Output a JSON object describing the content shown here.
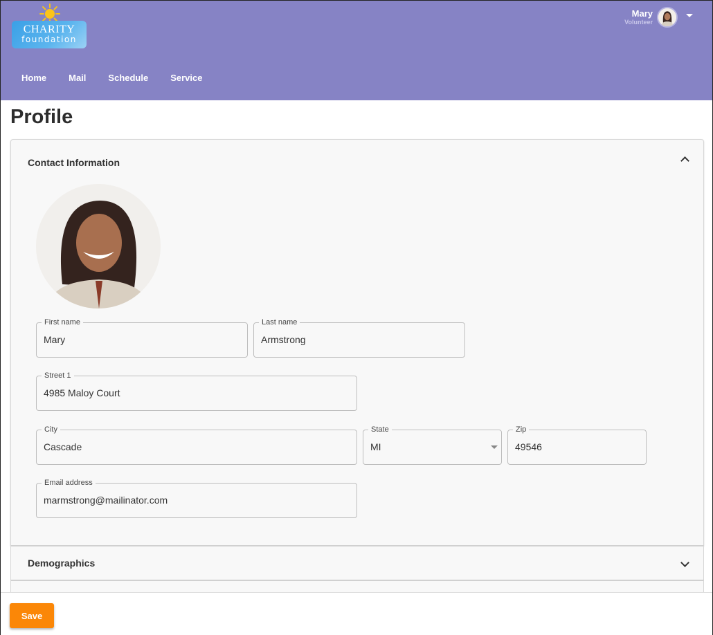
{
  "app": {
    "logo": {
      "line1": "CHARITY",
      "line2": "foundation"
    },
    "user": {
      "name": "Mary",
      "role": "Volunteer"
    },
    "nav": [
      {
        "label": "Home"
      },
      {
        "label": "Mail"
      },
      {
        "label": "Schedule"
      },
      {
        "label": "Service"
      }
    ],
    "colors": {
      "header": "#8683c5",
      "save_button": "#fb8707"
    }
  },
  "page": {
    "title": "Profile"
  },
  "contact": {
    "title": "Contact Information",
    "expanded": true,
    "fields": {
      "first_name": {
        "label": "First name",
        "value": "Mary"
      },
      "last_name": {
        "label": "Last name",
        "value": "Armstrong"
      },
      "street1": {
        "label": "Street 1",
        "value": "4985 Maloy Court"
      },
      "city": {
        "label": "City",
        "value": "Cascade"
      },
      "state": {
        "label": "State",
        "value": "MI"
      },
      "zip": {
        "label": "Zip",
        "value": "49546"
      },
      "email": {
        "label": "Email address",
        "value": "marmstrong@mailinator.com"
      }
    }
  },
  "demographics": {
    "title": "Demographics",
    "expanded": false
  },
  "footer": {
    "save_label": "Save"
  }
}
